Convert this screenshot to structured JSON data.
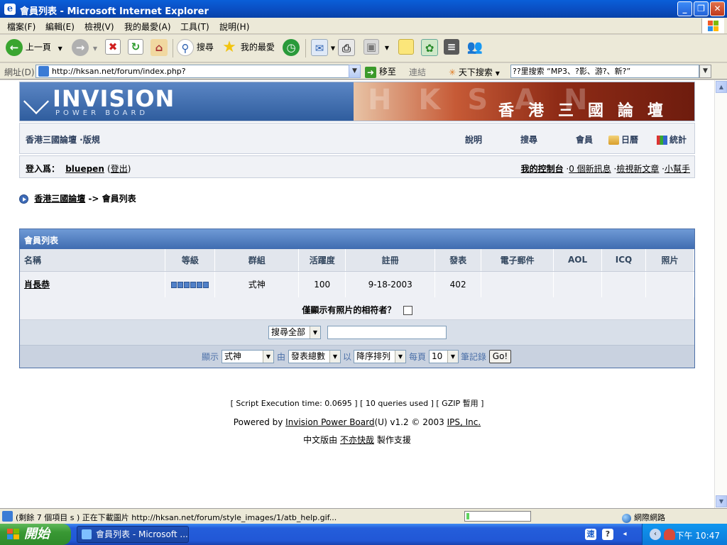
{
  "window": {
    "title": "會員列表 - Microsoft Internet Explorer",
    "min_icon": "minimize-icon",
    "max_icon": "maximize-icon",
    "close_icon": "close-icon"
  },
  "menu": [
    "檔案(F)",
    "編輯(E)",
    "檢視(V)",
    "我的最愛(A)",
    "工具(T)",
    "說明(H)"
  ],
  "toolbar": {
    "back": "上一頁",
    "search": "搜尋",
    "favorites": "我的最愛"
  },
  "address": {
    "label": "網址(D)",
    "url": "http://hksan.net/forum/index.php?",
    "go": "移至",
    "links": "連結",
    "tian_search": "天下搜索",
    "search_text": "??里搜索 “MP3、?影、游?、新?”"
  },
  "logo": {
    "brand": "INVISION",
    "sub": "POWER BOARD",
    "banner": "香港三國論壇"
  },
  "nav": {
    "home": "香港三國論壇 ·版規",
    "links": [
      "說明",
      "搜尋",
      "會員",
      "日曆",
      "統計"
    ]
  },
  "user": {
    "logged_in_label": "登入爲：",
    "username": "bluepen",
    "logout": "登出",
    "right_links": [
      "我的控制台",
      "0 個新訊息",
      "檢視新文章",
      "小幫手"
    ]
  },
  "breadcrumb": {
    "root": "香港三國論壇",
    "sep": "->",
    "current": "會員列表"
  },
  "members": {
    "title": "會員列表",
    "columns": [
      "名稱",
      "等級",
      "群組",
      "活躍度",
      "註冊",
      "發表",
      "電子郵件",
      "AOL",
      "ICQ",
      "照片"
    ],
    "rows": [
      {
        "name": "肖長恭",
        "rank_pips": 6,
        "group": "式神",
        "activity": "100",
        "joined": "9-18-2003",
        "posts": "402",
        "email": "",
        "aol": "",
        "icq": "",
        "photo": ""
      }
    ],
    "photo_only_label": "僅顯示有照片的相符者？",
    "search_select": "搜尋全部",
    "sort": {
      "show_label": "顯示",
      "show_value": "式神",
      "by_label": "由",
      "by_value": "發表總數",
      "order_label": "以",
      "order_value": "降序排列",
      "perpage_label": "每頁",
      "perpage_value": "10",
      "records_label": "筆記錄",
      "go": "Go!"
    }
  },
  "footer": {
    "stats": "[ Script Execution time: 0.0695 ]   [ 10 queries used ]   [ GZIP 暫用 ]",
    "powered_prefix": "Powered by ",
    "powered_link": "Invision Power Board",
    "powered_suffix": "(U) v1.2 © 2003  ",
    "ips": "IPS, Inc.",
    "cn_prefix": "中文版由 ",
    "cn_link": "不亦快哉",
    "cn_suffix": " 製作支援"
  },
  "status": {
    "text": "(剩餘 7 個項目 s ) 正在下載圖片 http://hksan.net/forum/style_images/1/atb_help.gif...",
    "progress": 0.05,
    "zone": "網際網路"
  },
  "taskbar": {
    "start": "開始",
    "task": "會員列表 - Microsoft ...",
    "clock": "下午 10:47"
  }
}
